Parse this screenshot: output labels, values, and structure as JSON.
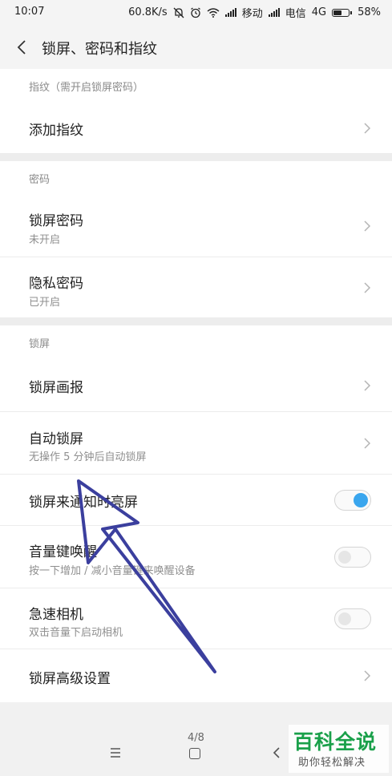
{
  "status_bar": {
    "time": "10:07",
    "net_speed": "60.8K/s",
    "carrier1": "移动",
    "carrier2": "电信",
    "network_type": "4G",
    "battery": "58%",
    "battery_level": 0.58
  },
  "header": {
    "title": "锁屏、密码和指纹"
  },
  "sections": {
    "fingerprint": {
      "header": "指纹（需开启锁屏密码）",
      "add": {
        "title": "添加指纹"
      }
    },
    "password": {
      "header": "密码",
      "lock_pwd": {
        "title": "锁屏密码",
        "subtitle": "未开启"
      },
      "privacy_pwd": {
        "title": "隐私密码",
        "subtitle": "已开启"
      }
    },
    "lockscreen": {
      "header": "锁屏",
      "wallpaper": {
        "title": "锁屏画报"
      },
      "auto_lock": {
        "title": "自动锁屏",
        "subtitle": "无操作 5 分钟后自动锁屏"
      },
      "notify_wake": {
        "title": "锁屏来通知时亮屏",
        "enabled": true
      },
      "volume_wake": {
        "title": "音量键唤醒",
        "subtitle": "按一下增加 / 减小音量键来唤醒设备",
        "enabled": false
      },
      "quick_camera": {
        "title": "急速相机",
        "subtitle": "双击音量下启动相机",
        "enabled": false
      },
      "advanced": {
        "title": "锁屏高级设置"
      }
    }
  },
  "page_indicator": "4/8",
  "watermark": {
    "line1": "百科全说",
    "line2": "助你轻松解决"
  },
  "colors": {
    "accent": "#3aa6ee",
    "arrow": "#3b3f9e",
    "watermark": "#1aa04a"
  }
}
